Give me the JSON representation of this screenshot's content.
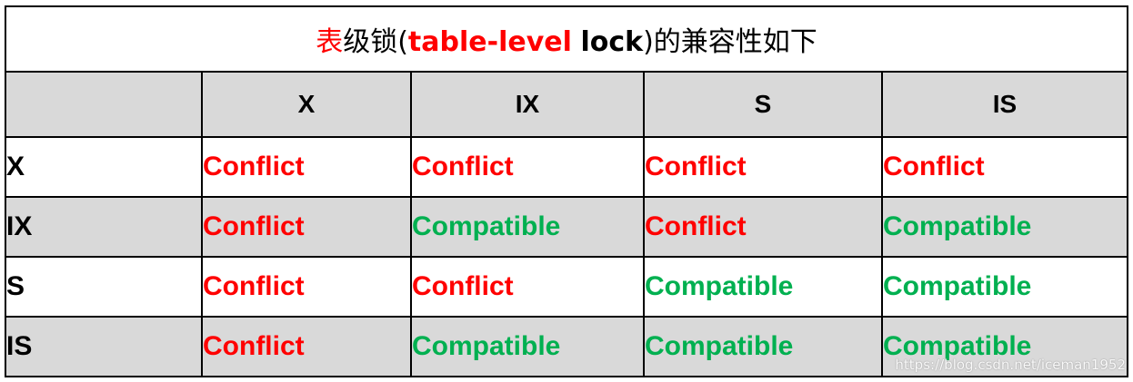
{
  "title": {
    "prefix": "表",
    "middle": "级锁(",
    "term": "table-level",
    "space": " ",
    "lock_word": "lock",
    "suffix": ")的兼容性如下"
  },
  "header": {
    "corner": "",
    "columns": [
      "X",
      "IX",
      "S",
      "IS"
    ]
  },
  "rows": [
    {
      "label": "X",
      "cells": [
        {
          "text": "Conflict",
          "kind": "conflict"
        },
        {
          "text": "Conflict",
          "kind": "conflict"
        },
        {
          "text": "Conflict",
          "kind": "conflict"
        },
        {
          "text": "Conflict",
          "kind": "conflict"
        }
      ]
    },
    {
      "label": "IX",
      "cells": [
        {
          "text": "Conflict",
          "kind": "conflict"
        },
        {
          "text": "Compatible",
          "kind": "compatible"
        },
        {
          "text": "Conflict",
          "kind": "conflict"
        },
        {
          "text": "Compatible",
          "kind": "compatible"
        }
      ]
    },
    {
      "label": "S",
      "cells": [
        {
          "text": "Conflict",
          "kind": "conflict"
        },
        {
          "text": "Conflict",
          "kind": "conflict"
        },
        {
          "text": "Compatible",
          "kind": "compatible"
        },
        {
          "text": "Compatible",
          "kind": "compatible"
        }
      ]
    },
    {
      "label": "IS",
      "cells": [
        {
          "text": "Conflict",
          "kind": "conflict"
        },
        {
          "text": "Compatible",
          "kind": "compatible"
        },
        {
          "text": "Compatible",
          "kind": "compatible"
        },
        {
          "text": "Compatible",
          "kind": "compatible"
        }
      ]
    }
  ],
  "colors": {
    "conflict": "#ff0000",
    "compatible": "#00b050",
    "header_bg": "#d9d9d9",
    "border": "#000000"
  },
  "watermark": "https://blog.csdn.net/iceman1952"
}
